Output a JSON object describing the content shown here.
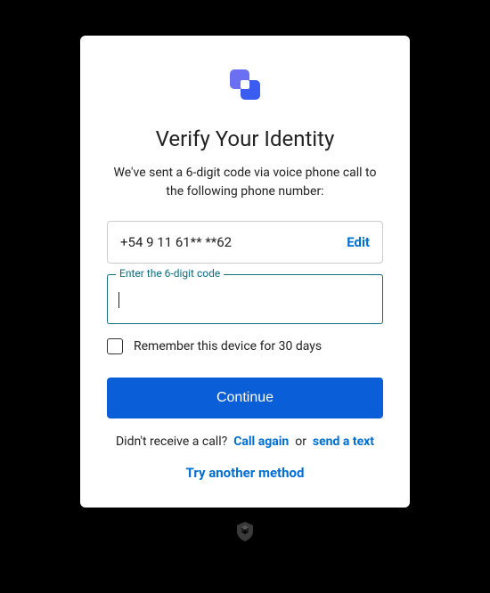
{
  "title": "Verify Your Identity",
  "subtitle": "We've sent a 6-digit code via voice phone call to the following phone number:",
  "phone": {
    "number": "+54 9 11 61** **62",
    "edit_label": "Edit"
  },
  "code_field": {
    "label": "Enter the 6-digit code",
    "value": ""
  },
  "remember": {
    "label": "Remember this device for 30 days"
  },
  "continue_label": "Continue",
  "resend": {
    "prompt": "Didn't receive a call?",
    "call_again": "Call again",
    "or": "or",
    "send_text": "send a text"
  },
  "try_another": "Try another method"
}
